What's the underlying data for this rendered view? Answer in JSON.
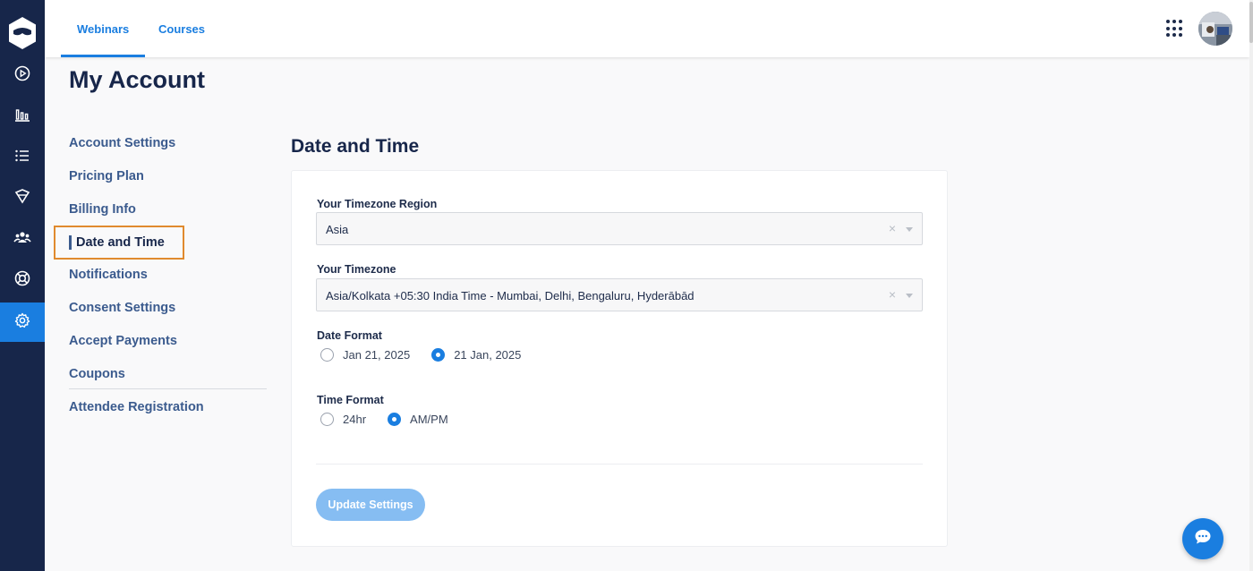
{
  "topbar": {
    "tabs": [
      {
        "label": "Webinars",
        "active": true
      },
      {
        "label": "Courses",
        "active": false
      }
    ]
  },
  "rail": {
    "items": [
      {
        "icon": "play-circle-icon"
      },
      {
        "icon": "bar-chart-icon"
      },
      {
        "icon": "list-icon"
      },
      {
        "icon": "integrations-icon"
      },
      {
        "icon": "users-icon"
      },
      {
        "icon": "lifebuoy-icon"
      },
      {
        "icon": "gear-icon",
        "active": true
      }
    ]
  },
  "page": {
    "title": "My Account"
  },
  "side_menu": {
    "items": [
      {
        "label": "Account Settings"
      },
      {
        "label": "Pricing Plan"
      },
      {
        "label": "Billing Info"
      },
      {
        "label": "Date and Time",
        "active": true
      },
      {
        "label": "Notifications"
      },
      {
        "label": "Consent Settings"
      },
      {
        "label": "Accept Payments"
      },
      {
        "label": "Coupons"
      },
      {
        "label": "Attendee Registration"
      }
    ]
  },
  "section": {
    "title": "Date and Time",
    "timezone_region": {
      "label": "Your Timezone Region",
      "value": "Asia",
      "clear": "×"
    },
    "timezone": {
      "label": "Your Timezone",
      "value": "Asia/Kolkata +05:30 India Time - Mumbai, Delhi, Bengaluru, Hyderābād",
      "clear": "×"
    },
    "date_format": {
      "label": "Date Format",
      "options": [
        {
          "label": "Jan 21, 2025",
          "checked": false
        },
        {
          "label": "21 Jan, 2025",
          "checked": true
        }
      ]
    },
    "time_format": {
      "label": "Time Format",
      "options": [
        {
          "label": "24hr",
          "checked": false
        },
        {
          "label": "AM/PM",
          "checked": true
        }
      ]
    },
    "update_button": "Update Settings"
  },
  "colors": {
    "rail": "#17264a",
    "accent": "#1a7ee0",
    "highlight_border": "#e08a2e",
    "disabled_button": "#86bdf2"
  }
}
